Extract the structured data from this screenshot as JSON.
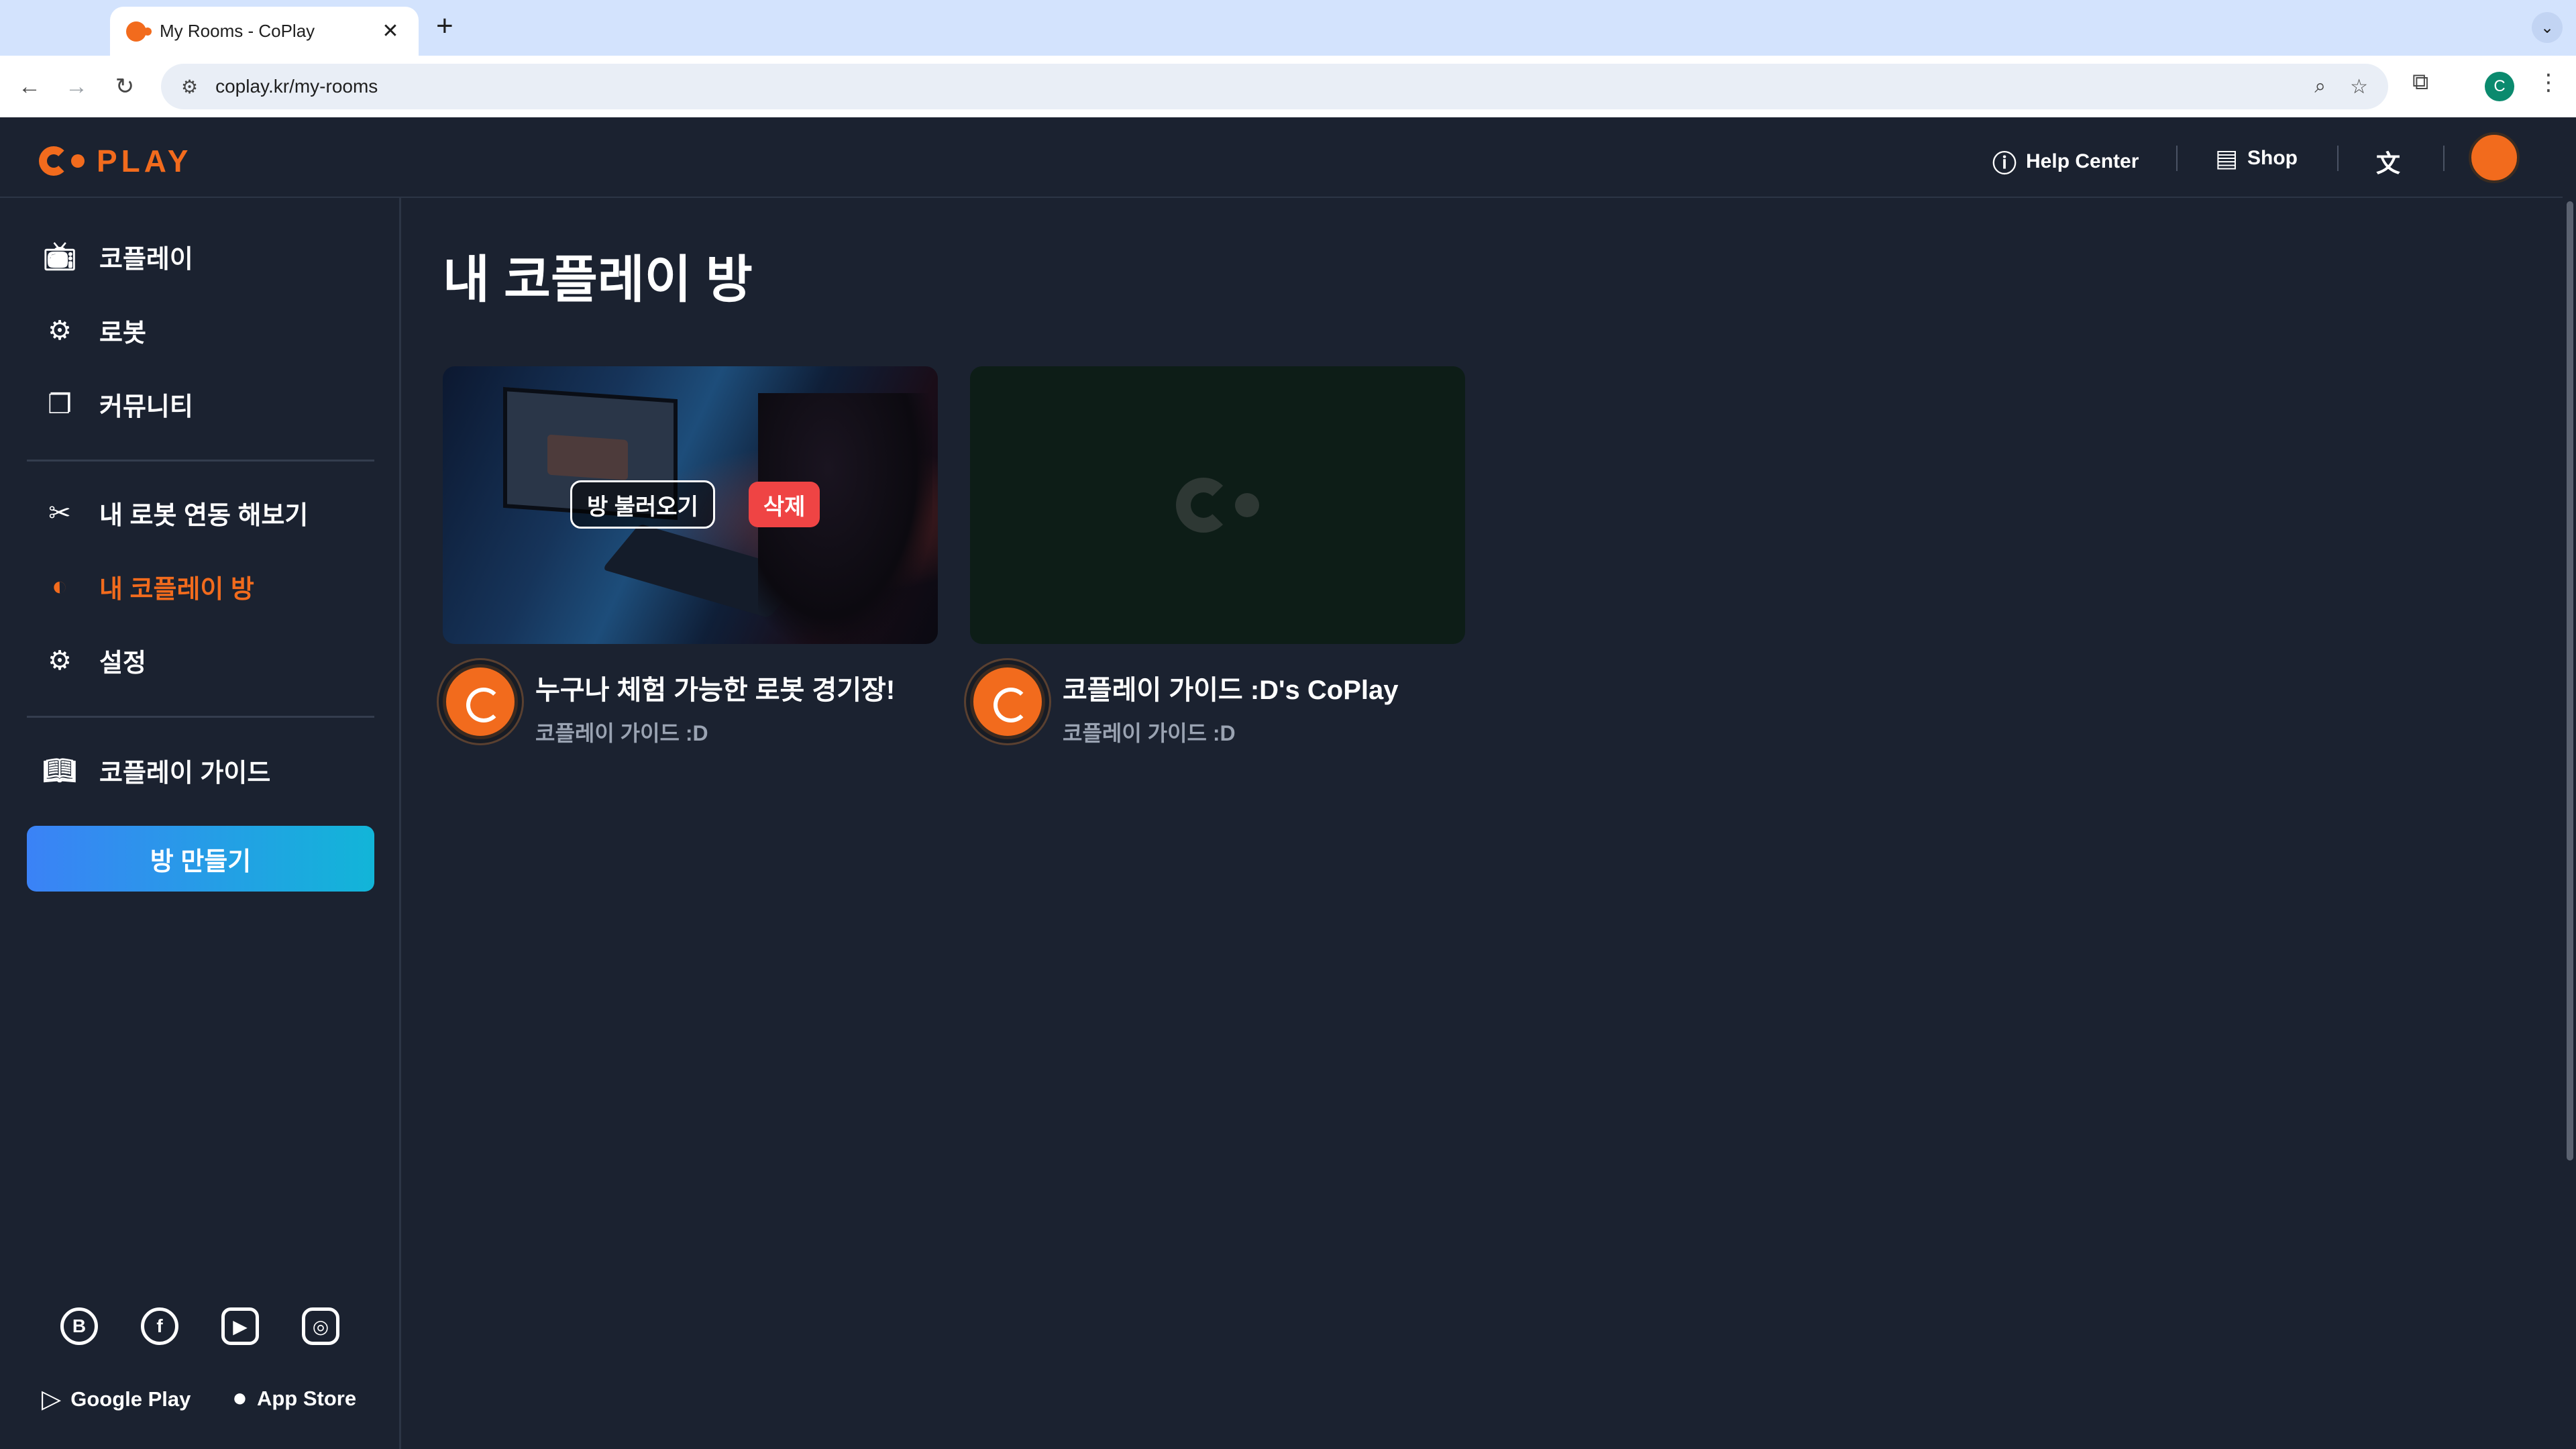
{
  "browser": {
    "tab_title": "My Rooms - CoPlay",
    "new_tab": "+",
    "close": "✕",
    "url": "coplay.kr/my-rooms",
    "profile_letter": "C"
  },
  "header": {
    "logo_text": "PLAY",
    "help_center": "Help Center",
    "shop": "Shop"
  },
  "sidebar": {
    "items": [
      {
        "label": "코플레이",
        "icon": "tv-icon"
      },
      {
        "label": "로봇",
        "icon": "robot-icon"
      },
      {
        "label": "커뮤니티",
        "icon": "chat-icon"
      },
      {
        "label": "내 로봇 연동 해보기",
        "icon": "tools-icon"
      },
      {
        "label": "내 코플레이 방",
        "icon": "play-circle-icon",
        "active": true
      },
      {
        "label": "설정",
        "icon": "gear-icon"
      },
      {
        "label": "코플레이 가이드",
        "icon": "book-icon"
      }
    ],
    "create_button": "방 만들기",
    "google_play": "Google Play",
    "app_store": "App Store"
  },
  "main": {
    "title": "내 코플레이 방",
    "cards": [
      {
        "title": "누구나 체험 가능한 로봇 경기장!",
        "owner": "코플레이 가이드 :D",
        "load_button": "방 불러오기",
        "delete_button": "삭제"
      },
      {
        "title": "코플레이 가이드 :D's CoPlay",
        "owner": "코플레이 가이드 :D"
      }
    ]
  },
  "colors": {
    "accent": "#f26b1d",
    "background": "#1b2230",
    "delete": "#ef4444",
    "create_gradient_start": "#3b82f6",
    "create_gradient_end": "#12b5d8"
  }
}
